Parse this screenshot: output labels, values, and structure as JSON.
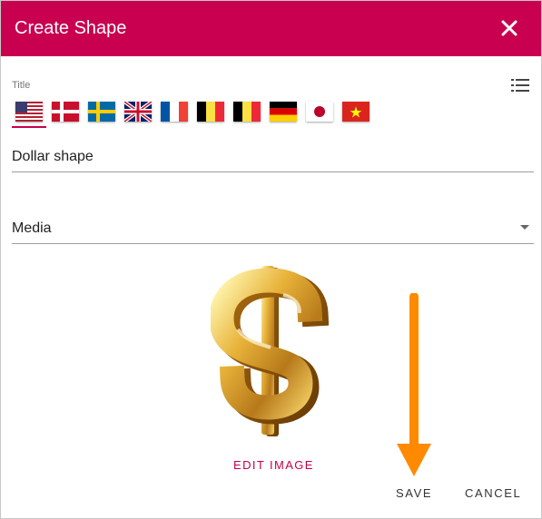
{
  "dialog": {
    "title": "Create Shape",
    "close_icon": "close-icon"
  },
  "title_section": {
    "label": "Title",
    "list_icon": "list-icon",
    "flags": [
      "us",
      "denmark",
      "sweden",
      "uk",
      "france",
      "belgium",
      "belgium",
      "germany",
      "japan",
      "vietnam"
    ],
    "active_flag": "us"
  },
  "fields": {
    "title_value": "Dollar shape",
    "media_value": "Media"
  },
  "image": {
    "icon": "dollar-sign-image"
  },
  "actions": {
    "edit_image": "EDIT IMAGE",
    "save": "SAVE",
    "cancel": "CANCEL"
  },
  "colors": {
    "header": "#c8004f",
    "accent": "#c8004f",
    "annotation_arrow": "#ff8a00"
  }
}
